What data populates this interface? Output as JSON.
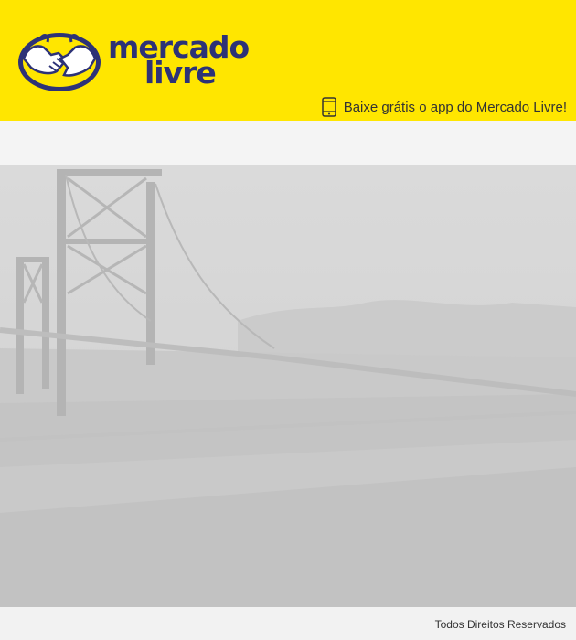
{
  "brand": {
    "name_line1": "mercado",
    "name_line2": "livre",
    "logo_icon": "handshake-icon",
    "colors": {
      "header_bg": "#ffe600",
      "brand_blue": "#2d3277"
    }
  },
  "header": {
    "app_promo": "Baixe grátis o app do Mercado Livre!",
    "app_icon": "smartphone-icon"
  },
  "footer": {
    "copyright": "Todos Direitos Reservados"
  }
}
